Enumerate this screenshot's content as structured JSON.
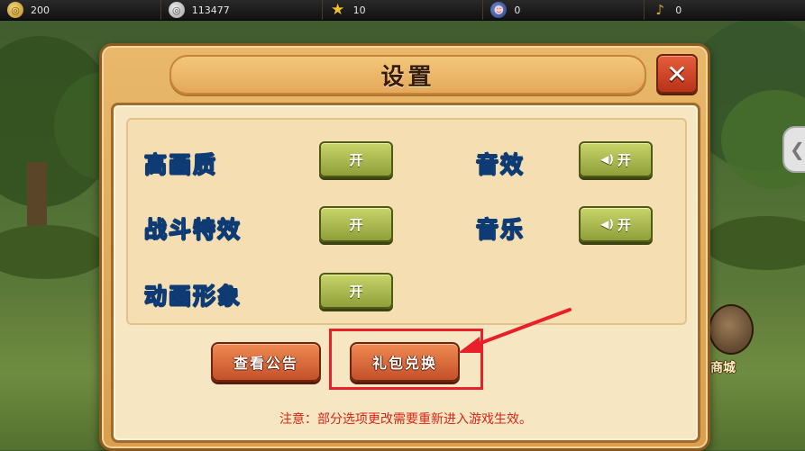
{
  "resources": [
    {
      "icon": "gold-coin-icon",
      "glyph": "◎",
      "value": "200"
    },
    {
      "icon": "silver-coin-icon",
      "glyph": "◎",
      "value": "113477"
    },
    {
      "icon": "star-icon",
      "glyph": "★",
      "value": "10"
    },
    {
      "icon": "mask-icon",
      "glyph": "☻",
      "value": "0"
    },
    {
      "icon": "horn-icon",
      "glyph": "♪",
      "value": "0"
    }
  ],
  "dialog": {
    "title": "设置",
    "close_glyph": "✕",
    "options": [
      {
        "label": "高画质",
        "toggle": "开",
        "sound": false
      },
      {
        "label": "战斗特效",
        "toggle": "开",
        "sound": false
      },
      {
        "label": "动画形象",
        "toggle": "开",
        "sound": false
      },
      {
        "label": "音效",
        "toggle": "开",
        "sound": true,
        "sound_glyph": "◀)"
      },
      {
        "label": "音乐",
        "toggle": "开",
        "sound": true,
        "sound_glyph": "◀)"
      }
    ],
    "buttons": {
      "announcement": "查看公告",
      "gift_exchange": "礼包兑换"
    },
    "notice": "注意：部分选项更改需要重新进入游戏生效。"
  },
  "side": {
    "tab_glyph": "❮",
    "shop_label": "商城"
  },
  "colors": {
    "highlight": "#e8202a",
    "label_blue": "#3fa5e6",
    "notice_red": "#d8261a"
  }
}
